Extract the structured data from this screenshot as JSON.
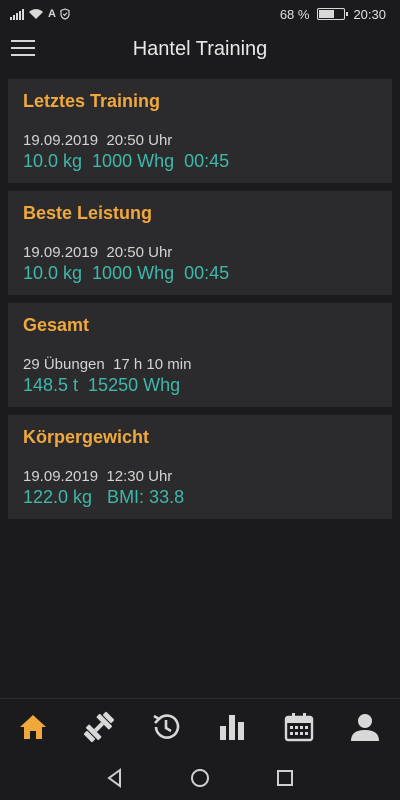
{
  "status_bar": {
    "network_label": "A",
    "battery_percent": "68 %",
    "battery_level": 0.68,
    "time": "20:30"
  },
  "app_bar": {
    "title": "Hantel Training",
    "menu_icon": "hamburger-menu-icon"
  },
  "cards": [
    {
      "title": "Letztes Training",
      "line1": "19.09.2019  20:50 Uhr",
      "line2": "10.0 kg  1000 Whg  00:45"
    },
    {
      "title": "Beste Leistung",
      "line1": "19.09.2019  20:50 Uhr",
      "line2": "10.0 kg  1000 Whg  00:45"
    },
    {
      "title": "Gesamt",
      "line1": "29 Übungen  17 h 10 min",
      "line2": "148.5 t  15250 Whg"
    },
    {
      "title": "Körpergewicht",
      "line1": "19.09.2019  12:30 Uhr",
      "line2": "122.0 kg   BMI: 33.8"
    }
  ],
  "bottom_nav": {
    "items": [
      "home-icon",
      "dumbbell-icon",
      "history-icon",
      "bar-chart-icon",
      "calendar-icon",
      "profile-icon"
    ],
    "active_index": 0
  },
  "colors": {
    "background": "#1b1b1d",
    "card": "#2b2b2e",
    "accent_title": "#f0a83c",
    "accent_value": "#3fb8a8",
    "nav_active": "#f0a83c",
    "nav_inactive": "#d8d8d8"
  }
}
